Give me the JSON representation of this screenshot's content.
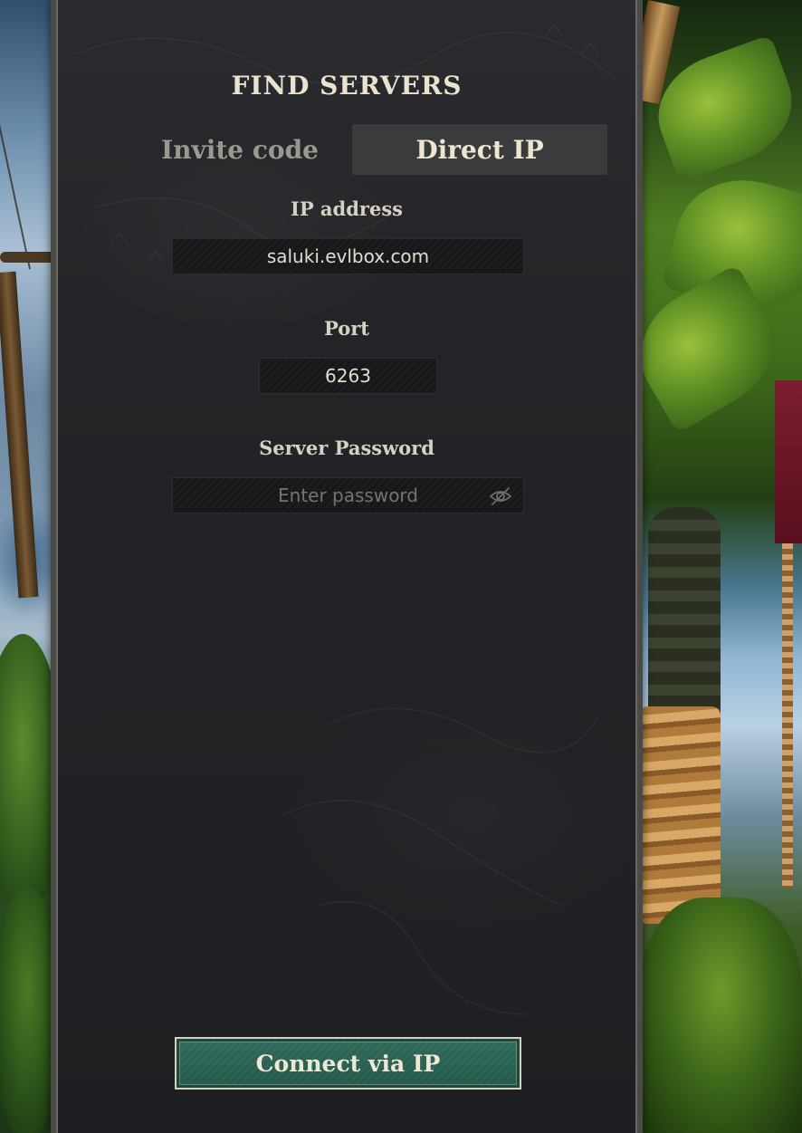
{
  "panel": {
    "title": "FIND SERVERS",
    "tabs": [
      {
        "label": "Invite code",
        "active": false
      },
      {
        "label": "Direct IP",
        "active": true
      }
    ]
  },
  "form": {
    "ip": {
      "label": "IP address",
      "value": "saluki.evlbox.com"
    },
    "port": {
      "label": "Port",
      "value": "6263"
    },
    "password": {
      "label": "Server Password",
      "placeholder": "Enter password",
      "toggle_icon": "eye-slash-icon"
    }
  },
  "actions": {
    "connect_label": "Connect via IP"
  },
  "colors": {
    "accent": "#2f6a5a",
    "panel_bg": "#232427",
    "text_primary": "#ece3cf",
    "text_muted": "#9b988f"
  }
}
